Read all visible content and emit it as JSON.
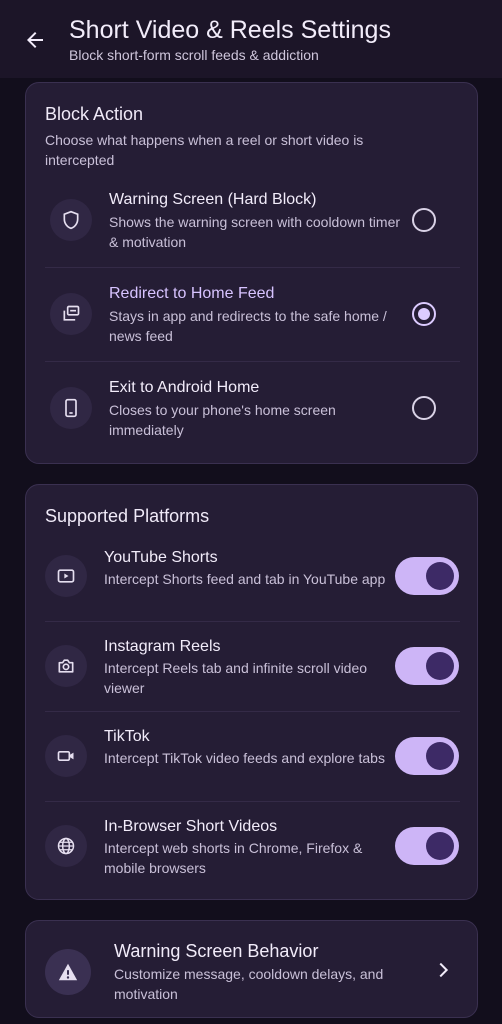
{
  "header": {
    "title": "Short Video & Reels Settings",
    "subtitle": "Block short-form scroll feeds & addiction"
  },
  "block_action": {
    "title": "Block Action",
    "description": "Choose what happens when a reel or short video is intercepted",
    "options": [
      {
        "title": "Warning Screen (Hard Block)",
        "description": "Shows the warning screen with cooldown timer & motivation",
        "icon": "shield-icon",
        "selected": false
      },
      {
        "title": "Redirect to Home Feed",
        "description": "Stays in app and redirects to the safe home / news feed",
        "icon": "redirect-icon",
        "selected": true
      },
      {
        "title": "Exit to Android Home",
        "description": "Closes to your phone's home screen immediately",
        "icon": "phone-icon",
        "selected": false
      }
    ]
  },
  "platforms": {
    "title": "Supported Platforms",
    "items": [
      {
        "title": "YouTube Shorts",
        "description": "Intercept Shorts feed and tab in YouTube app",
        "icon": "play-icon",
        "enabled": true
      },
      {
        "title": "Instagram Reels",
        "description": "Intercept Reels tab and infinite scroll video viewer",
        "icon": "camera-icon",
        "enabled": true
      },
      {
        "title": "TikTok",
        "description": "Intercept TikTok video feeds and explore tabs",
        "icon": "video-icon",
        "enabled": true
      },
      {
        "title": "In-Browser Short Videos",
        "description": "Intercept web shorts in Chrome, Firefox & mobile browsers",
        "icon": "globe-icon",
        "enabled": true
      }
    ]
  },
  "warning_behavior": {
    "title": "Warning Screen Behavior",
    "description": "Customize message, cooldown delays, and motivation",
    "icon": "warning-icon"
  },
  "colors": {
    "background": "#120e1c",
    "card": "#251d35",
    "accent": "#cdb5f7"
  }
}
